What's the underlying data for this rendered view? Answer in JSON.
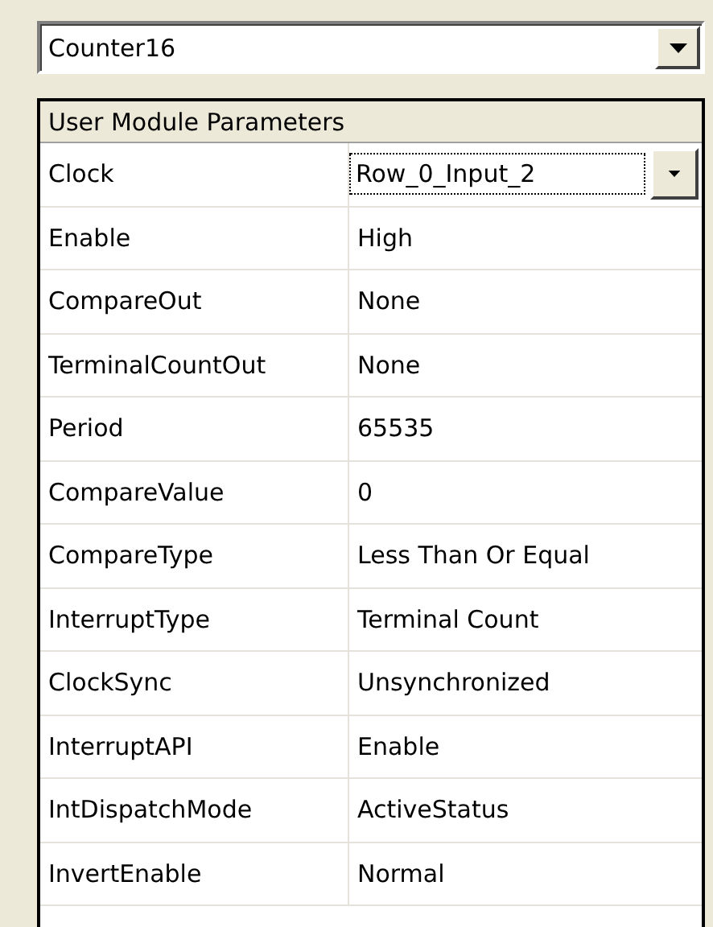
{
  "module_select": {
    "value": "Counter16"
  },
  "parameters": {
    "title": "User Module Parameters",
    "rows": [
      {
        "name": "Clock",
        "value": "Row_0_Input_2",
        "kind": "dropdown"
      },
      {
        "name": "Enable",
        "value": "High",
        "kind": "text"
      },
      {
        "name": "CompareOut",
        "value": "None",
        "kind": "text"
      },
      {
        "name": "TerminalCountOut",
        "value": "None",
        "kind": "text"
      },
      {
        "name": "Period",
        "value": "65535",
        "kind": "text"
      },
      {
        "name": "CompareValue",
        "value": "0",
        "kind": "text"
      },
      {
        "name": "CompareType",
        "value": "Less Than Or Equal",
        "kind": "text"
      },
      {
        "name": "InterruptType",
        "value": "Terminal Count",
        "kind": "text"
      },
      {
        "name": "ClockSync",
        "value": "Unsynchronized",
        "kind": "text"
      },
      {
        "name": "InterruptAPI",
        "value": "Enable",
        "kind": "text"
      },
      {
        "name": "IntDispatchMode",
        "value": "ActiveStatus",
        "kind": "text"
      },
      {
        "name": "InvertEnable",
        "value": "Normal",
        "kind": "text"
      }
    ]
  }
}
